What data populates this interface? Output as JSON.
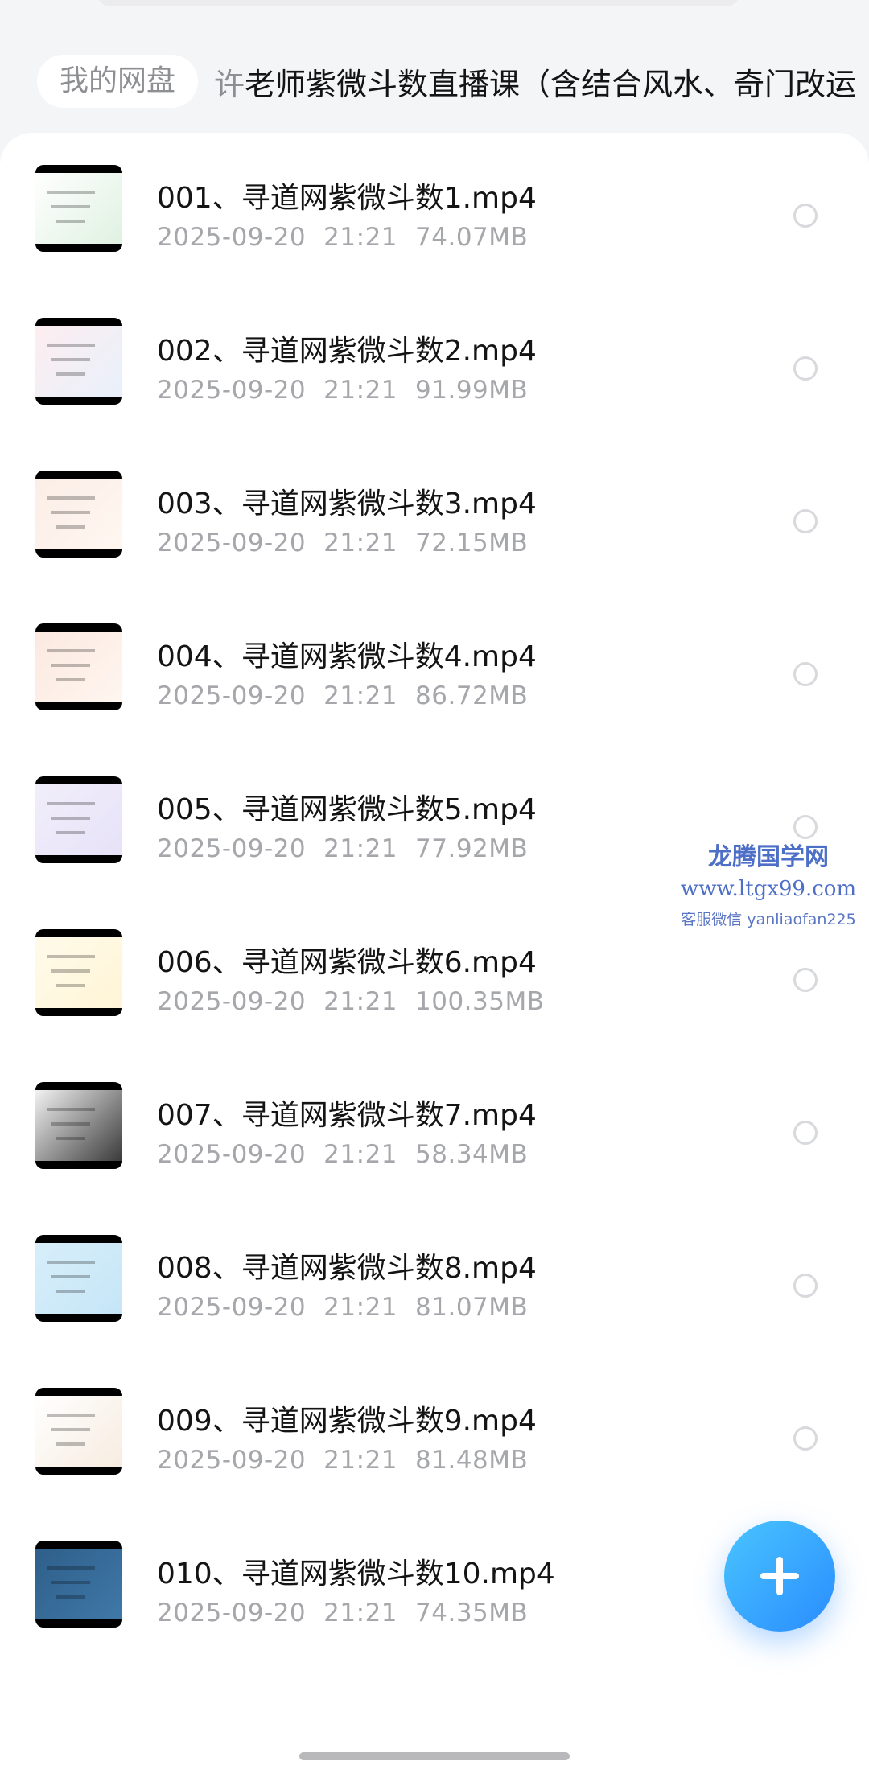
{
  "breadcrumb": {
    "root": "我的网盘",
    "current_prefix": "许",
    "current_rest": "老师紫微斗数直播课（含结合风水、奇门改运"
  },
  "files": [
    {
      "name": "001、寻道网紫微斗数1.mp4",
      "date": "2025-09-20",
      "time": "21:21",
      "size": "74.07MB",
      "thumb": "thumb-chat",
      "colors": [
        "#ffffff",
        "#dff1e1"
      ]
    },
    {
      "name": "002、寻道网紫微斗数2.mp4",
      "date": "2025-09-20",
      "time": "21:21",
      "size": "91.99MB",
      "thumb": "thumb-chart-grid",
      "colors": [
        "#fdeef0",
        "#e8f0fb"
      ]
    },
    {
      "name": "003、寻道网紫微斗数3.mp4",
      "date": "2025-09-20",
      "time": "21:21",
      "size": "72.15MB",
      "thumb": "thumb-slide-text",
      "colors": [
        "#fbeee6",
        "#fff7f1"
      ]
    },
    {
      "name": "004、寻道网紫微斗数4.mp4",
      "date": "2025-09-20",
      "time": "21:21",
      "size": "86.72MB",
      "thumb": "thumb-slide-title",
      "colors": [
        "#fbe9e0",
        "#fff6f0"
      ]
    },
    {
      "name": "005、寻道网紫微斗数5.mp4",
      "date": "2025-09-20",
      "time": "21:21",
      "size": "77.92MB",
      "thumb": "thumb-bubbles",
      "colors": [
        "#f1eefb",
        "#e7e2f8"
      ]
    },
    {
      "name": "006、寻道网紫微斗数6.mp4",
      "date": "2025-09-20",
      "time": "21:21",
      "size": "100.35MB",
      "thumb": "thumb-table",
      "colors": [
        "#fffbea",
        "#fff4d6"
      ]
    },
    {
      "name": "007、寻道网紫微斗数7.mp4",
      "date": "2025-09-20",
      "time": "21:21",
      "size": "58.34MB",
      "thumb": "thumb-body-diagram",
      "colors": [
        "#f2f2f2",
        "#3a3a3a"
      ]
    },
    {
      "name": "008、寻道网紫微斗数8.mp4",
      "date": "2025-09-20",
      "time": "21:21",
      "size": "81.07MB",
      "thumb": "thumb-flow",
      "colors": [
        "#d8eefa",
        "#c5e6f7"
      ]
    },
    {
      "name": "009、寻道网紫微斗数9.mp4",
      "date": "2025-09-20",
      "time": "21:21",
      "size": "81.48MB",
      "thumb": "thumb-doc",
      "colors": [
        "#ffffff",
        "#f7ece0"
      ]
    },
    {
      "name": "010、寻道网紫微斗数10.mp4",
      "date": "2025-09-20",
      "time": "21:21",
      "size": "74.35MB",
      "thumb": "thumb-blue-slide",
      "colors": [
        "#2f5f8a",
        "#3f78a8"
      ]
    }
  ],
  "watermark": {
    "line1": "龙腾国学网",
    "line2": "www.ltgx99.com",
    "line3": "客服微信 yanliaofan225"
  },
  "fab": {
    "icon": "plus-icon"
  }
}
